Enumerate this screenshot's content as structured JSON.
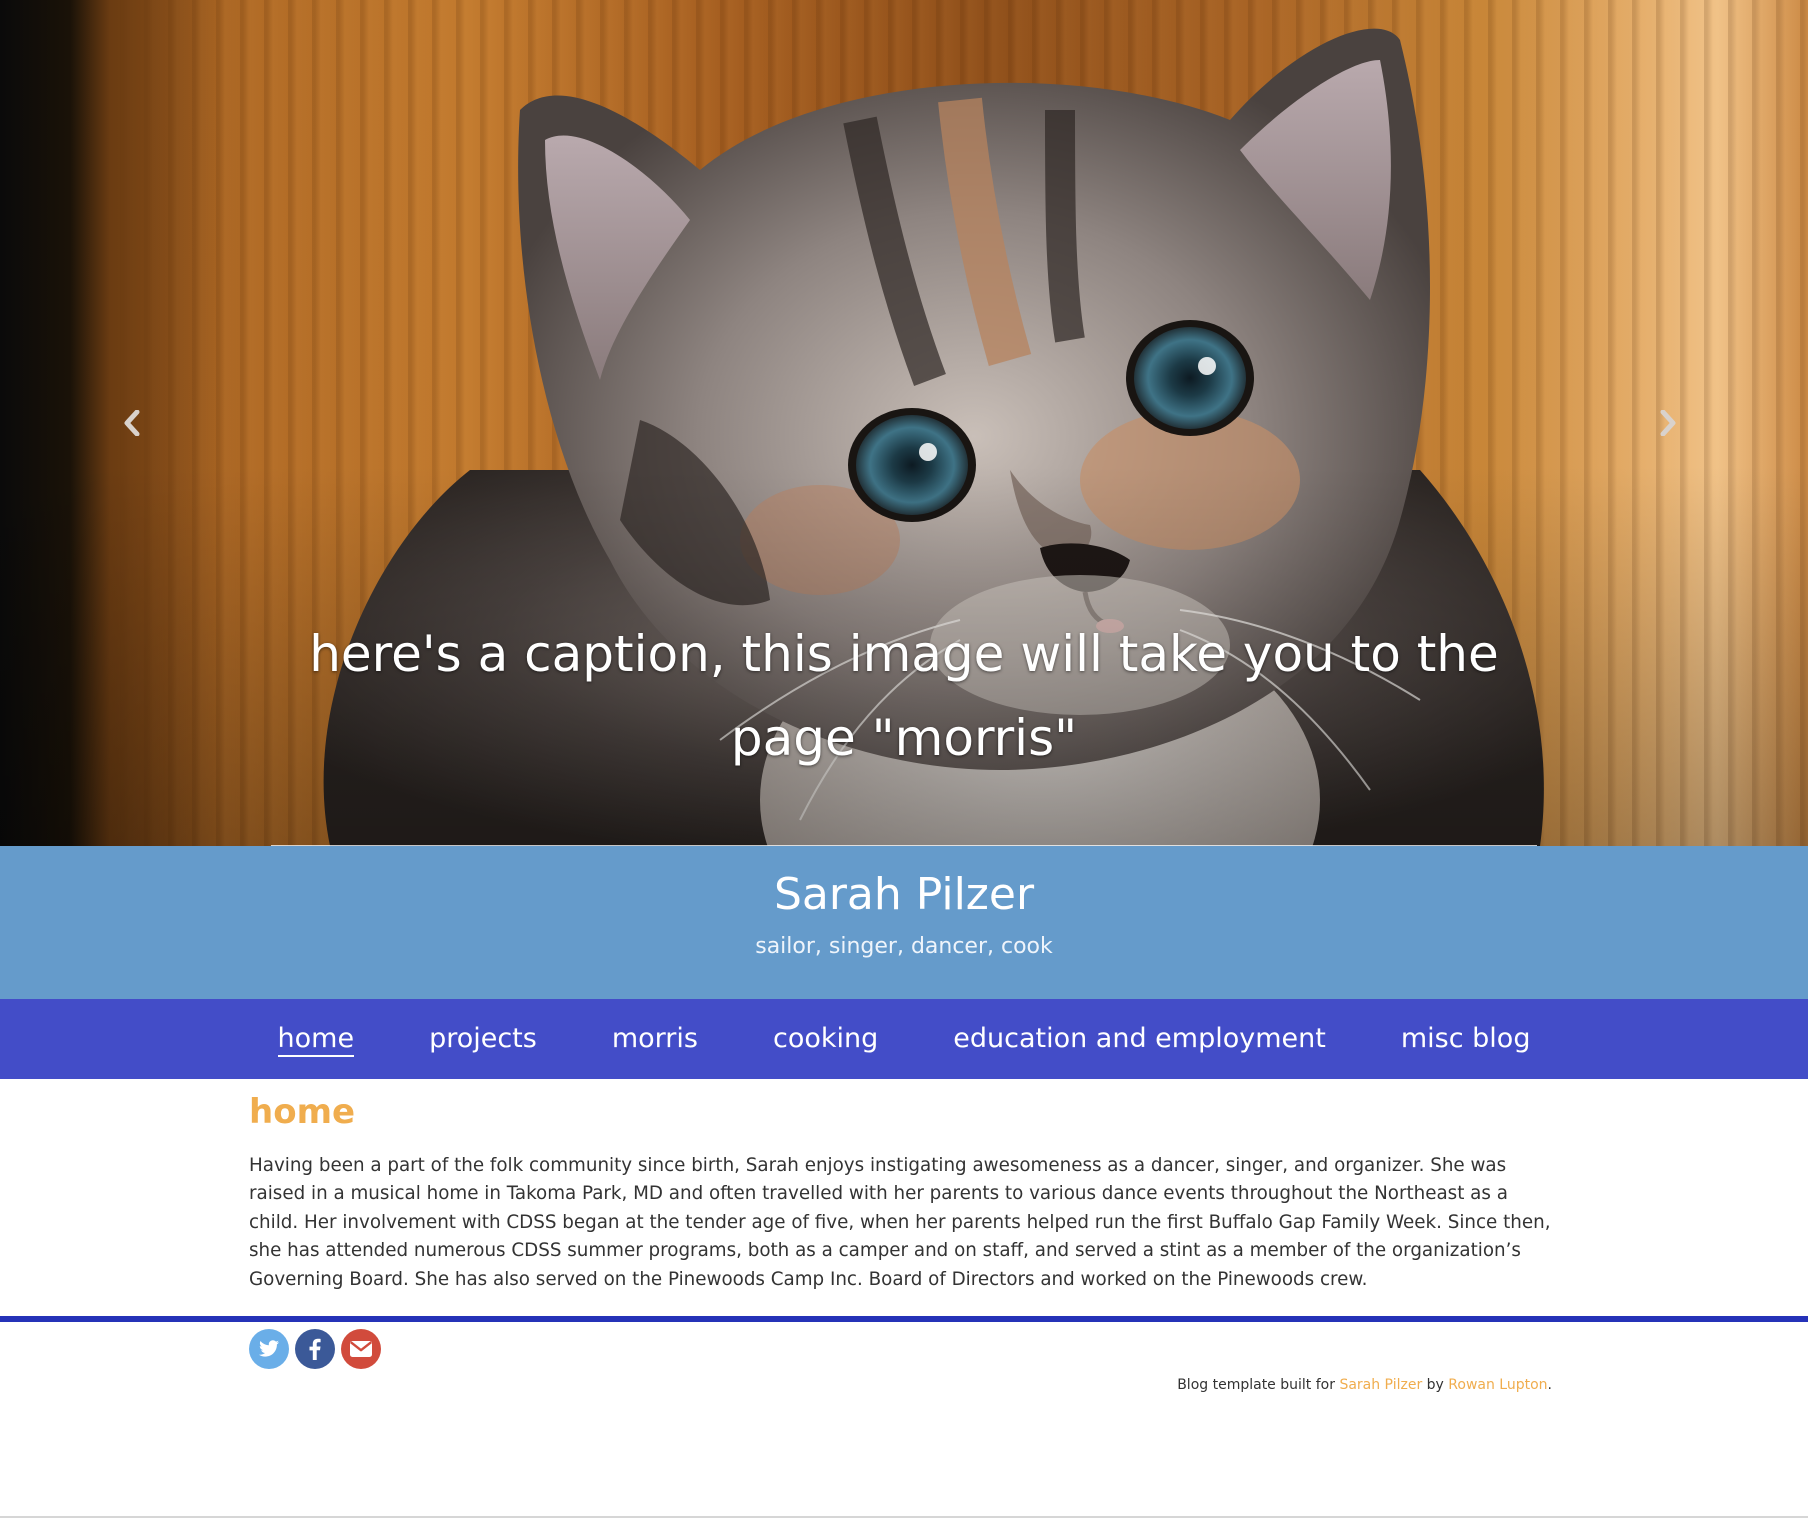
{
  "carousel": {
    "caption": "here's a caption, this image will take you to the page \"morris\"",
    "image_subject": "kitten photo",
    "prev_icon": "chevron-left-icon",
    "next_icon": "chevron-right-icon"
  },
  "header": {
    "title": "Sarah Pilzer",
    "tagline": "sailor, singer, dancer, cook",
    "background": "#659bcb"
  },
  "nav": {
    "background": "#434dc8",
    "items": [
      {
        "label": "home",
        "active": true
      },
      {
        "label": "projects",
        "active": false
      },
      {
        "label": "morris",
        "active": false
      },
      {
        "label": "cooking",
        "active": false
      },
      {
        "label": "education and employment",
        "active": false
      },
      {
        "label": "misc blog",
        "active": false
      }
    ]
  },
  "main": {
    "heading": "home",
    "heading_color": "#f0ad4e",
    "body": "Having been a part of the folk community since birth, Sarah enjoys instigating awesomeness as a dancer, singer, and organizer. She was raised in a musical home in Takoma Park, MD and often travelled with her parents to various dance events throughout the Northeast as a child. Her involvement with CDSS began at the tender age of five, when her parents helped run the first Buffalo Gap Family Week. Since then, she has attended numerous CDSS summer programs, both as a camper and on staff, and served a stint as a member of the organization’s Governing Board. She has also served on the Pinewoods Camp Inc. Board of Directors and worked on the Pinewoods crew."
  },
  "footer": {
    "rule_color": "#2532b8",
    "social": [
      {
        "icon": "twitter-icon",
        "color": "#6aaee8"
      },
      {
        "icon": "facebook-icon",
        "color": "#3b5998"
      },
      {
        "icon": "email-icon",
        "color": "#d14b3c"
      }
    ],
    "credit": {
      "prefix": "Blog template built for ",
      "author_link": "Sarah Pilzer",
      "middle": " by ",
      "builder_link": "Rowan Lupton",
      "suffix": "."
    }
  }
}
